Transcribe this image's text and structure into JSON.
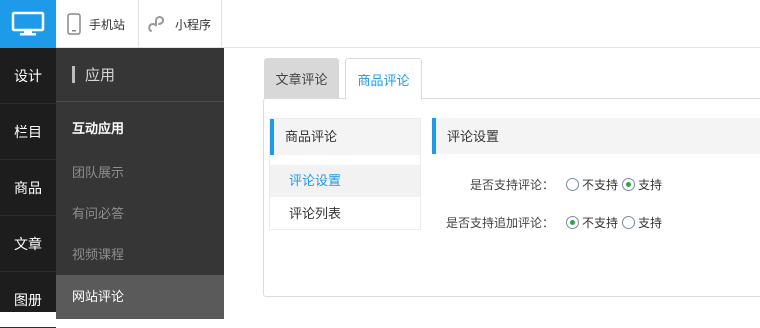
{
  "topbar": {
    "devices": [
      {
        "label": "手机站",
        "icon": "mobile-phone-icon"
      },
      {
        "label": "小程序",
        "icon": "mini-program-icon"
      }
    ],
    "logo_icon": "desktop-monitor-icon"
  },
  "nav1": {
    "items": [
      "设计",
      "栏目",
      "商品",
      "文章",
      "图册"
    ]
  },
  "nav2": {
    "title": "应用",
    "group": "互动应用",
    "items": [
      "团队展示",
      "有问必答",
      "视频课程",
      "网站评论"
    ],
    "active_index": 3
  },
  "tabs": [
    {
      "label": "文章评论",
      "active": false
    },
    {
      "label": "商品评论",
      "active": true
    }
  ],
  "submenu": {
    "title": "商品评论",
    "items": [
      {
        "label": "评论设置",
        "active": true
      },
      {
        "label": "评论列表",
        "active": false
      }
    ]
  },
  "settings": {
    "title": "评论设置",
    "rows": [
      {
        "label": "是否支持评论：",
        "options": [
          "不支持",
          "支持"
        ],
        "selected": 1
      },
      {
        "label": "是否支持追加评论：",
        "options": [
          "不支持",
          "支持"
        ],
        "selected": 0
      }
    ]
  },
  "colors": {
    "accent": "#1e9be8",
    "nav_dark": "#1d1d1d",
    "nav_mid": "#363636",
    "radio_on": "#35a149"
  }
}
